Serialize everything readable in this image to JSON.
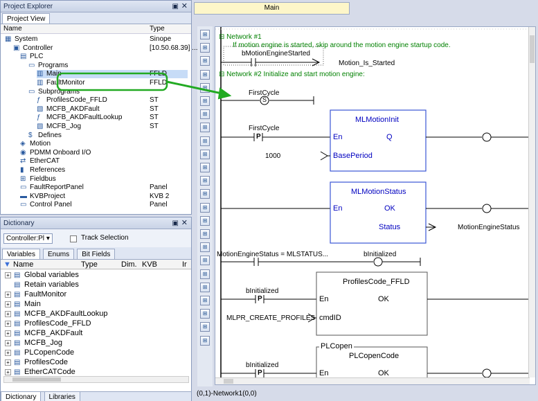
{
  "project_explorer": {
    "title": "Project Explorer",
    "tab": "Project View",
    "col_name": "Name",
    "col_type": "Type",
    "tree": [
      {
        "label": "System",
        "type": "Sinope",
        "icon": "system-icon"
      },
      {
        "label": "Controller",
        "type": "[10.50.68.39] ...",
        "icon": "controller-icon"
      },
      {
        "label": "PLC",
        "type": "",
        "icon": "plc-icon"
      },
      {
        "label": "Programs",
        "type": "",
        "icon": "folder-icon"
      },
      {
        "label": "Main",
        "type": "FFLD",
        "icon": "program-icon"
      },
      {
        "label": "FaultMonitor",
        "type": "FFLD",
        "icon": "program-icon"
      },
      {
        "label": "Subprograms",
        "type": "",
        "icon": "folder-icon"
      },
      {
        "label": "ProfilesCode_FFLD",
        "type": "ST",
        "icon": "function-icon"
      },
      {
        "label": "MCFB_AKDFault",
        "type": "ST",
        "icon": "fb-icon"
      },
      {
        "label": "MCFB_AKDFaultLookup",
        "type": "ST",
        "icon": "function-icon"
      },
      {
        "label": "MCFB_Jog",
        "type": "ST",
        "icon": "fb-icon"
      },
      {
        "label": "Defines",
        "type": "",
        "icon": "defines-icon"
      },
      {
        "label": "Motion",
        "type": "",
        "icon": "motion-icon"
      },
      {
        "label": "PDMM Onboard I/O",
        "type": "",
        "icon": "io-icon"
      },
      {
        "label": "EtherCAT",
        "type": "",
        "icon": "ethercat-icon"
      },
      {
        "label": "References",
        "type": "",
        "icon": "references-icon"
      },
      {
        "label": "Fieldbus",
        "type": "",
        "icon": "fieldbus-icon"
      },
      {
        "label": "FaultReportPanel",
        "type": "Panel",
        "icon": "panel-icon"
      },
      {
        "label": "KVBProject",
        "type": "KVB 2",
        "icon": "kvb-icon"
      },
      {
        "label": "Control Panel",
        "type": "Panel",
        "icon": "panel-icon"
      }
    ]
  },
  "dictionary": {
    "title": "Dictionary",
    "scope_select": "Controller:Pl",
    "track_selection": "Track Selection",
    "tabs": [
      "Variables",
      "Enums",
      "Bit Fields"
    ],
    "columns": [
      "Name",
      "Type",
      "Dim.",
      "KVB",
      "Ir"
    ],
    "rows": [
      "Global variables",
      "Retain variables",
      "FaultMonitor",
      "Main",
      "MCFB_AKDFaultLookup",
      "ProfilesCode_FFLD",
      "MCFB_AKDFault",
      "MCFB_Jog",
      "PLCopenCode",
      "ProfilesCode",
      "EtherCATCode"
    ],
    "bottom_tabs": [
      "Dictionary",
      "Libraries"
    ]
  },
  "editor": {
    "tab": "Main",
    "status": "(0,1)-Network1(0,0)",
    "network1_title": "Network #1",
    "network1_comment": "If motion engine is started, skip around the motion engine startup code.",
    "n1_contact": "bMotionEngineStarted",
    "n1_jump": "Motion_Is_Started",
    "network2_title": "Network #2 Initialize and start motion engine:",
    "first_cycle": "FirstCycle",
    "set_coil": "S",
    "first_cycle2": "FirstCycle",
    "p_contact": "P",
    "fb1_name": "MLMotionInit",
    "fb1_en": "En",
    "fb1_q": "Q",
    "fb1_in": "BasePeriod",
    "fb1_const": "1000",
    "fb2_name": "MLMotionStatus",
    "fb2_en": "En",
    "fb2_ok": "OK",
    "fb2_status": "Status",
    "fb2_out": "MotionEngineStatus",
    "cmp_contact": "MotionEngineStatus = MLSTATUS...",
    "binit_coil": "bInitialized",
    "binit1": "bInitialized",
    "fb3_name": "ProfilesCode_FFLD",
    "fb3_en": "En",
    "fb3_ok": "OK",
    "fb3_in": "cmdID",
    "fb3_const": "MLPR_CREATE_PROFILES",
    "plc_group": "PLCopen",
    "fb4_name": "PLCopenCode",
    "binit2": "bInitialized",
    "fb4_en": "En",
    "fb4_ok": "OK"
  },
  "colors": {
    "highlight": "#22aa22",
    "fb_border": "#3a55d4",
    "network_text": "#0000c0"
  }
}
